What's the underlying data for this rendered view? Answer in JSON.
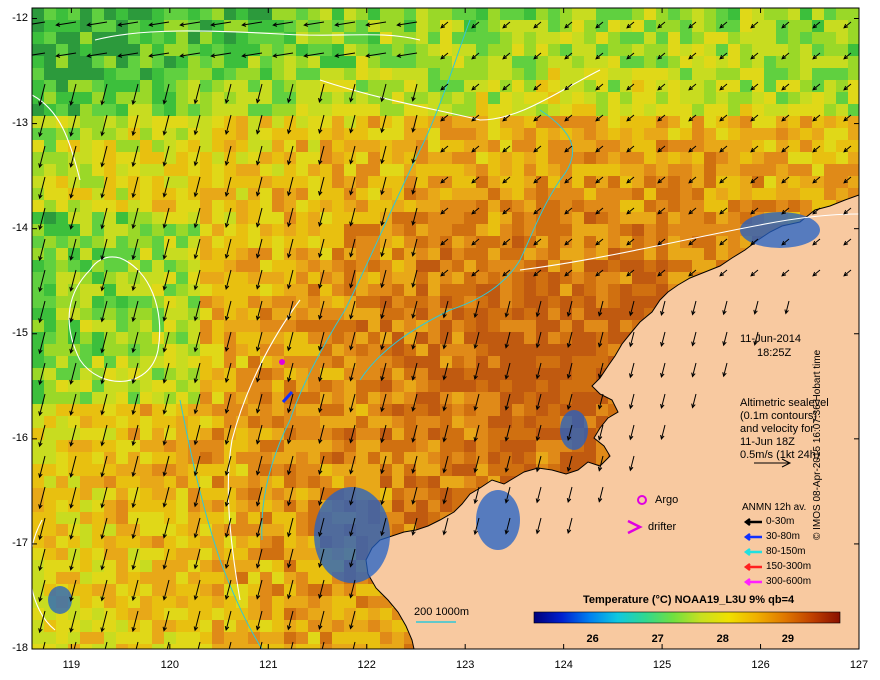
{
  "map": {
    "lat_ticks": [
      "-12",
      "-13",
      "-14",
      "-15",
      "-16",
      "-17",
      "-18"
    ],
    "lon_ticks": [
      "119",
      "120",
      "121",
      "122",
      "123",
      "124",
      "125",
      "126",
      "127"
    ],
    "lat_range": [
      -18,
      -11.9
    ],
    "lon_range": [
      118.6,
      127
    ],
    "grid": true
  },
  "info": {
    "date": "11-Jun-2014",
    "time": "18:25Z",
    "altimetry_lines": [
      "Altimetric sealevel",
      "(0.1m contours)",
      "and velocity for",
      "11-Jun 18Z",
      "0.5m/s (1kt 24h)"
    ]
  },
  "markers": {
    "argo_label": "Argo",
    "drifter_label": "drifter",
    "argo_color": "#e000e0",
    "drifter_color": "#e000e0"
  },
  "anmn": {
    "title": "ANMN 12h av.",
    "items": [
      {
        "label": "0-30m",
        "color": "#000000"
      },
      {
        "label": "30-80m",
        "color": "#1030ff"
      },
      {
        "label": "80-150m",
        "color": "#20e0e0"
      },
      {
        "label": "150-300m",
        "color": "#ff2020"
      },
      {
        "label": "300-600m",
        "color": "#ff20ff"
      }
    ]
  },
  "isobath": {
    "label": "200  1000m",
    "color": "#30c8d8"
  },
  "colorbar": {
    "title": "Temperature (°C) NOAA19_L3U 9% qb=4",
    "ticks": [
      "26",
      "27",
      "28",
      "29"
    ],
    "tick_values": [
      26,
      27,
      28,
      29
    ],
    "range": [
      25.1,
      29.8
    ],
    "colors": [
      "#00007a",
      "#0020d0",
      "#0080f0",
      "#10c8e0",
      "#30d890",
      "#70e040",
      "#c8e020",
      "#f0e000",
      "#f0b000",
      "#e07800",
      "#c04000",
      "#8a1000"
    ]
  },
  "credit": "© IMOS 08-Apr-2015 16:07:36 Hobart time"
}
